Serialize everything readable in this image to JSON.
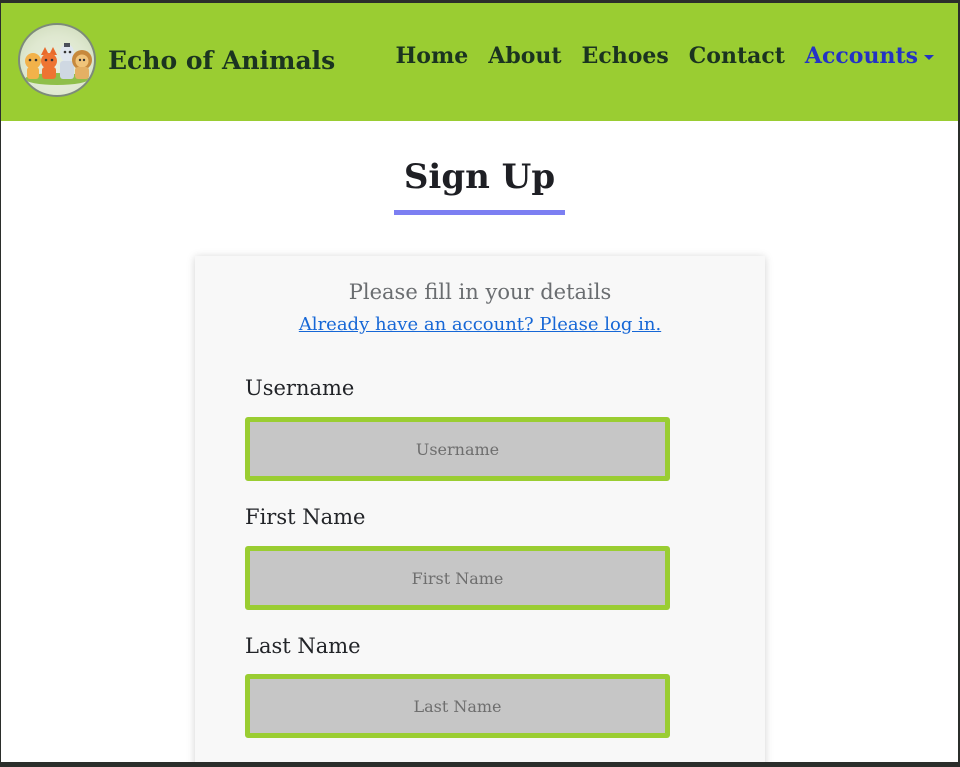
{
  "navbar": {
    "brand_name": "Echo of Animals",
    "logo_icon": "animals-logo-icon",
    "background_color": "#9acd32",
    "links": [
      {
        "label": "Home"
      },
      {
        "label": "About"
      },
      {
        "label": "Echoes"
      },
      {
        "label": "Contact"
      },
      {
        "label": "Accounts",
        "active": true,
        "dropdown": true
      }
    ],
    "active_color": "#2433c4"
  },
  "page": {
    "title": "Sign Up",
    "underline_color": "#7c7ff2"
  },
  "form": {
    "subtitle": "Please fill in your details",
    "login_link": "Already have an account? Please log in.",
    "fields": [
      {
        "label": "Username",
        "placeholder": "Username",
        "value": ""
      },
      {
        "label": "First Name",
        "placeholder": "First Name",
        "value": ""
      },
      {
        "label": "Last Name",
        "placeholder": "Last Name",
        "value": ""
      }
    ],
    "input_border_color": "#9acd32",
    "input_background": "#c6c6c6"
  }
}
